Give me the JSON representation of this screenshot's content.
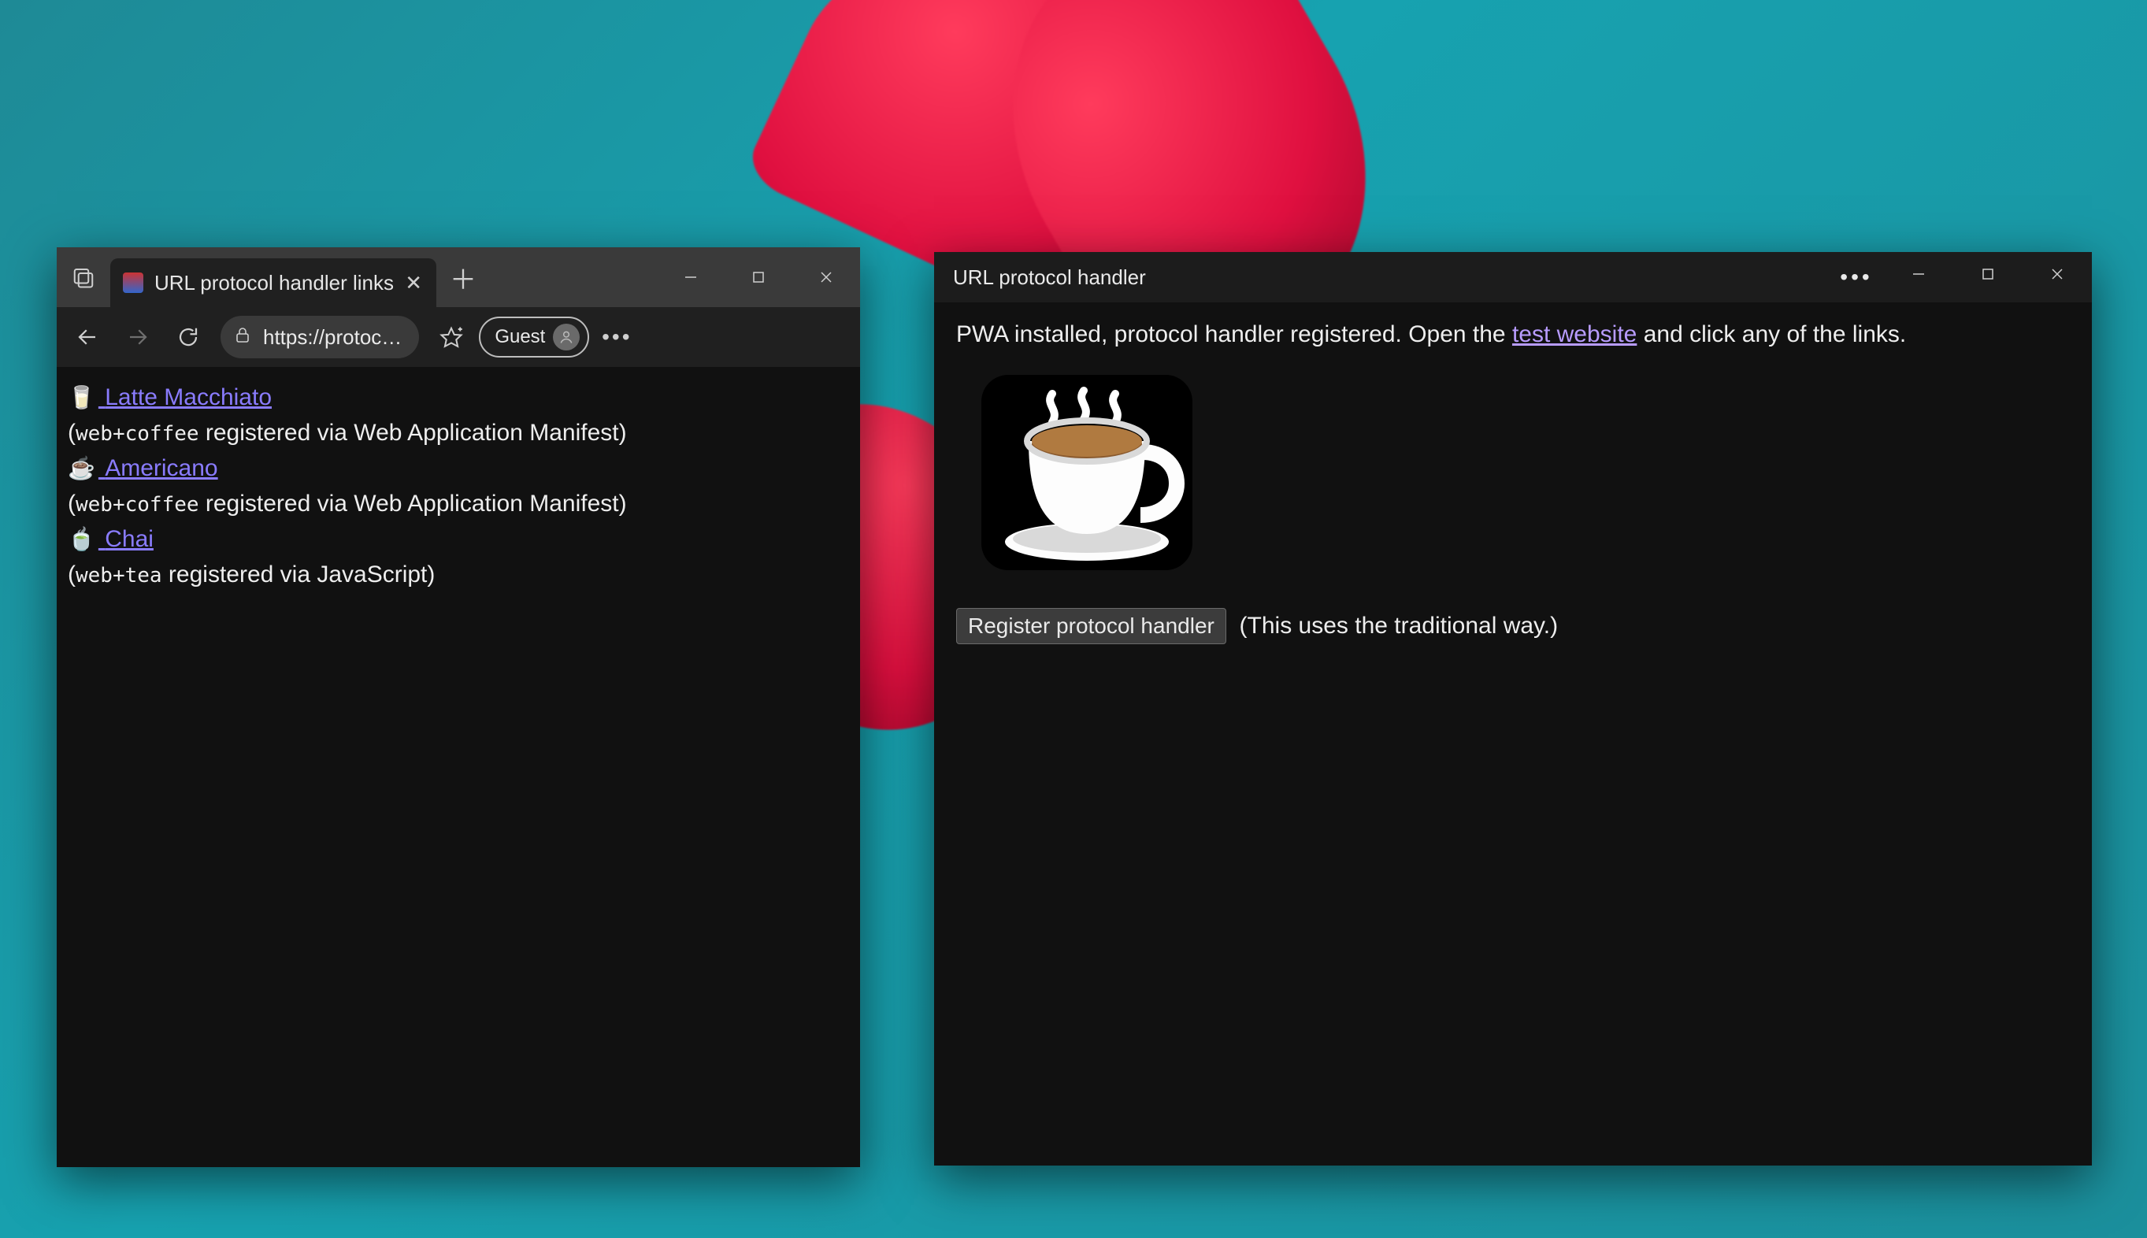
{
  "browser": {
    "tab_title": "URL protocol handler links",
    "address": "https://protoc…",
    "guest_label": "Guest",
    "links": [
      {
        "emoji": "🥛",
        "label": "Latte Macchiato",
        "proto": "web+coffee",
        "note_suffix": " registered via Web Application Manifest)"
      },
      {
        "emoji": "☕",
        "label": "Americano",
        "proto": "web+coffee",
        "note_suffix": " registered via Web Application Manifest)"
      },
      {
        "emoji": "🍵",
        "label": "Chai",
        "proto": "web+tea",
        "note_suffix": " registered via JavaScript)"
      }
    ]
  },
  "pwa": {
    "title": "URL protocol handler",
    "intro_prefix": "PWA installed, protocol handler registered. Open the ",
    "intro_link": "test website",
    "intro_suffix": " and click any of the links.",
    "button_label": "Register protocol handler",
    "button_note": "(This uses the traditional way.)"
  }
}
